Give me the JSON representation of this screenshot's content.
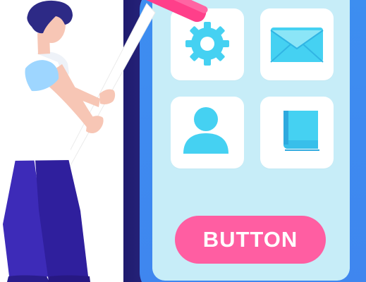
{
  "phone": {
    "button_label": "BUTTON"
  },
  "tiles": [
    {
      "icon": "gear-icon"
    },
    {
      "icon": "mail-icon"
    },
    {
      "icon": "user-icon"
    },
    {
      "icon": "book-icon"
    }
  ],
  "colors": {
    "phone_frame": "#3f86ef",
    "screen": "#c7edf8",
    "accent_icon": "#45d1f2",
    "button": "#ff5ea2",
    "roller_pink": "#ff3f8a",
    "shirt": "#ffffff",
    "pants": "#3d2bb8"
  }
}
